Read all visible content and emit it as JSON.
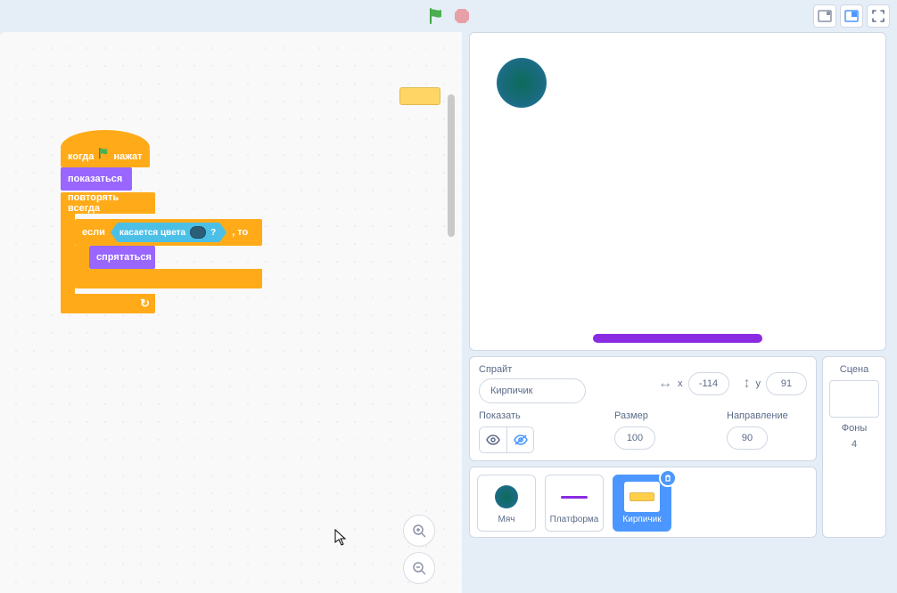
{
  "blocks": {
    "hat_prefix": "когда",
    "hat_suffix": "нажат",
    "show": "показаться",
    "forever": "повторять всегда",
    "if_prefix": "если",
    "if_suffix": ", то",
    "touching_color": "касается цвета",
    "touching_q": "?",
    "hide": "спрятаться"
  },
  "sprite_info": {
    "label": "Спрайт",
    "name": "Кирпичик",
    "x_label": "x",
    "x": "-114",
    "y_label": "y",
    "y": "91",
    "show_label": "Показать",
    "size_label": "Размер",
    "size": "100",
    "direction_label": "Направление",
    "direction": "90"
  },
  "stage_panel": {
    "label": "Сцена",
    "backdrops_label": "Фоны",
    "backdrops_count": "4"
  },
  "sprites": [
    {
      "name": "Мяч"
    },
    {
      "name": "Платформа"
    },
    {
      "name": "Кирпичик"
    }
  ],
  "colors": {
    "touch_swatch": "#2b5f78"
  }
}
